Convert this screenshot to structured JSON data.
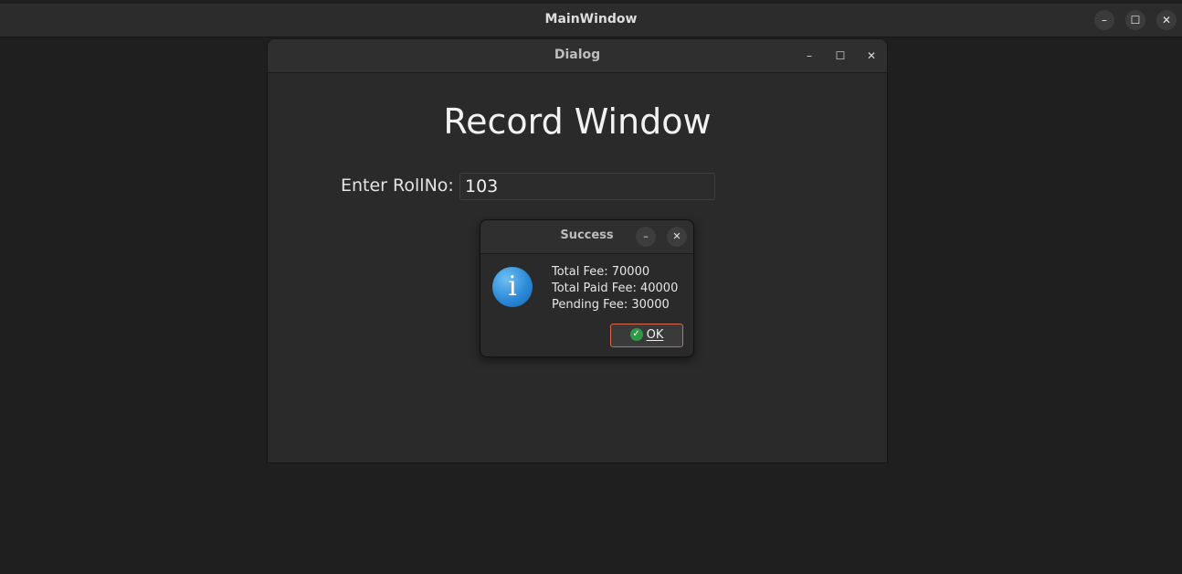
{
  "main_window": {
    "title": "MainWindow",
    "controls": {
      "minimize": "–",
      "maximize": "☐",
      "close": "✕"
    }
  },
  "dialog": {
    "title": "Dialog",
    "controls": {
      "minimize": "–",
      "maximize": "☐",
      "close": "✕"
    },
    "heading": "Record Window",
    "roll_label": "Enter RollNo:",
    "roll_value": "103"
  },
  "message_box": {
    "title": "Success",
    "controls": {
      "minimize": "–",
      "close": "✕"
    },
    "icon": "information-icon",
    "lines": [
      "Total Fee: 70000",
      "Total Paid Fee: 40000",
      "Pending Fee: 30000"
    ],
    "ok_label": "OK"
  },
  "colors": {
    "background": "#1f1f1f",
    "info_icon": "#2c8ad8",
    "ok_border": "#d9694a",
    "ok_check": "#2e9a45"
  }
}
